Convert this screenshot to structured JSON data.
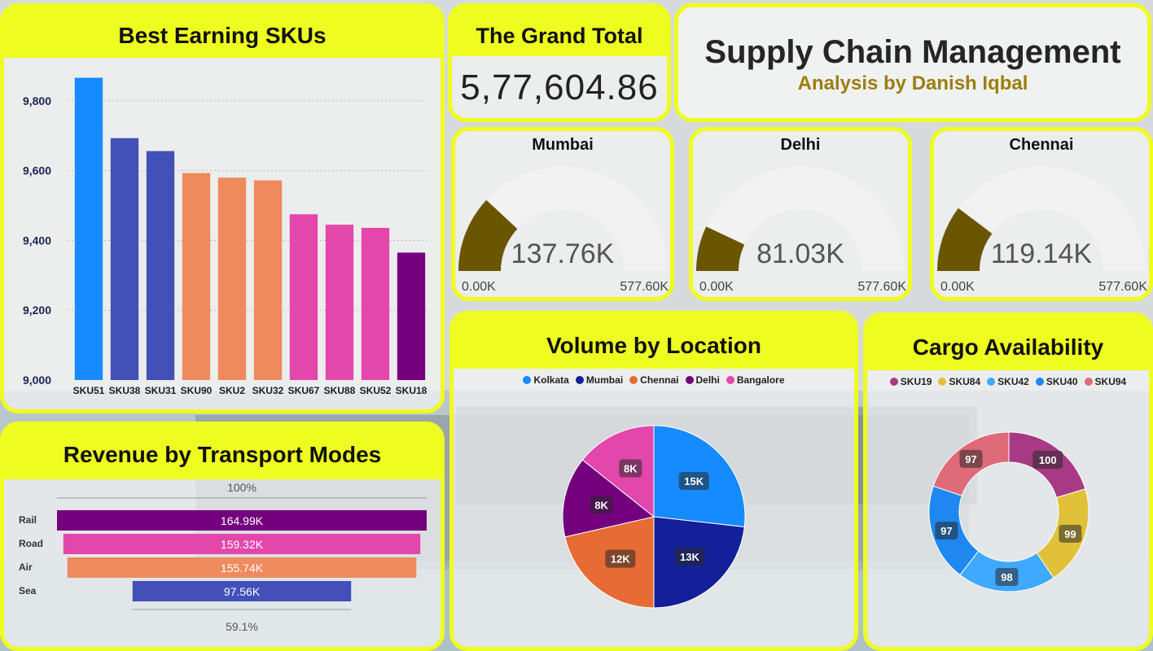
{
  "header": {
    "title": "Supply Chain Management",
    "subtitle": "Analysis by Danish Iqbal"
  },
  "grand_total": {
    "title": "The Grand Total",
    "value": "5,77,604.86"
  },
  "gauges": [
    {
      "name": "Mumbai",
      "value": 137.76,
      "label": "137.76K",
      "min_label": "0.00K",
      "max_label": "577.60K",
      "max": 577.6
    },
    {
      "name": "Delhi",
      "value": 81.03,
      "label": "81.03K",
      "min_label": "0.00K",
      "max_label": "577.60K",
      "max": 577.6
    },
    {
      "name": "Chennai",
      "value": 119.14,
      "label": "119.14K",
      "min_label": "0.00K",
      "max_label": "577.60K",
      "max": 577.6
    }
  ],
  "colors": {
    "accent": "#eefc1f",
    "gauge_fill": "#6b5600",
    "subtitle": "#9b7e0e"
  },
  "chart_data": [
    {
      "type": "bar",
      "title": "Best Earning SKUs",
      "categories": [
        "SKU51",
        "SKU38",
        "SKU31",
        "SKU90",
        "SKU2",
        "SKU32",
        "SKU67",
        "SKU88",
        "SKU52",
        "SKU18"
      ],
      "values": [
        9866,
        9693,
        9656,
        9593,
        9580,
        9572,
        9475,
        9445,
        9436,
        9365
      ],
      "colors": [
        "#168aff",
        "#4250b8",
        "#4250b8",
        "#ee8a5c",
        "#ee8a5c",
        "#ee8a5c",
        "#e347ab",
        "#e347ab",
        "#e347ab",
        "#74007e"
      ],
      "ylim": [
        9000,
        9900
      ],
      "yticks": [
        "9,000",
        "9,200",
        "9,400",
        "9,600",
        "9,800"
      ],
      "ytick_values": [
        9000,
        9200,
        9400,
        9600,
        9800
      ],
      "grid": true
    },
    {
      "type": "bar",
      "orientation": "horizontal-funnel",
      "title": "Revenue by Transport Modes",
      "categories": [
        "Rail",
        "Road",
        "Air",
        "Sea"
      ],
      "values": [
        164.99,
        159.32,
        155.74,
        97.56
      ],
      "labels": [
        "164.99K",
        "159.32K",
        "155.74K",
        "97.56K"
      ],
      "colors": [
        "#74007e",
        "#e347ab",
        "#ee8a5c",
        "#4250b8"
      ],
      "top_label": "100%",
      "bottom_label": "59.1%"
    },
    {
      "type": "pie",
      "title": "Volume by Location",
      "legend": [
        "Kolkata",
        "Mumbai",
        "Chennai",
        "Delhi",
        "Bangalore"
      ],
      "legend_colors": [
        "#168aff",
        "#14209a",
        "#e66b35",
        "#74007e",
        "#e347ab"
      ],
      "slices": [
        {
          "name": "Kolkata",
          "value": 15,
          "label": "15K",
          "color": "#168aff"
        },
        {
          "name": "Mumbai",
          "value": 13,
          "label": "13K",
          "color": "#14209a"
        },
        {
          "name": "Chennai",
          "value": 12,
          "label": "12K",
          "color": "#e66b35"
        },
        {
          "name": "Delhi",
          "value": 8,
          "label": "8K",
          "color": "#74007e"
        },
        {
          "name": "Bangalore",
          "value": 8,
          "label": "8K",
          "color": "#e347ab"
        }
      ],
      "legend_placement": "top"
    },
    {
      "type": "pie",
      "variant": "donut",
      "title": "Cargo Availability",
      "legend": [
        "SKU19",
        "SKU84",
        "SKU42",
        "SKU40",
        "SKU94"
      ],
      "slices": [
        {
          "name": "SKU19",
          "value": 100,
          "label": "100",
          "color": "#a83a85"
        },
        {
          "name": "SKU84",
          "value": 99,
          "label": "99",
          "color": "#e2c13a"
        },
        {
          "name": "SKU42",
          "value": 98,
          "label": "98",
          "color": "#3fa8ff"
        },
        {
          "name": "SKU40",
          "value": 97,
          "label": "97",
          "color": "#1e88f0"
        },
        {
          "name": "SKU94",
          "value": 97,
          "label": "97",
          "color": "#df6a7a"
        }
      ],
      "legend_placement": "top"
    }
  ]
}
